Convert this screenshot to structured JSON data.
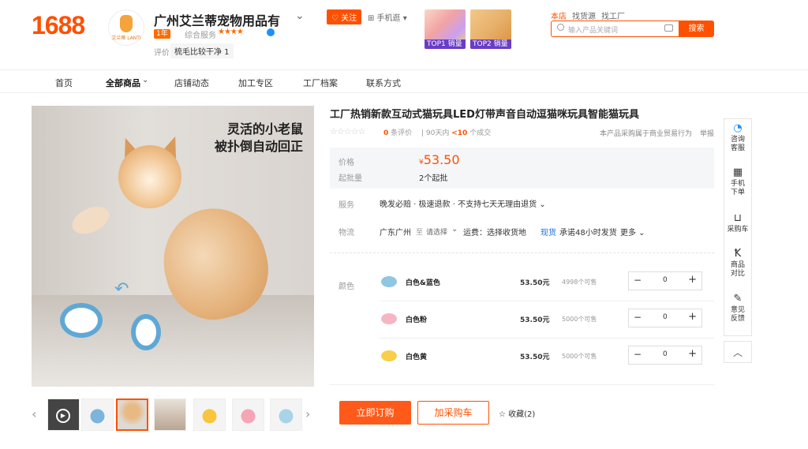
{
  "header": {
    "logo": "1688",
    "shop_avatar_label": "艾兰蒂 LANTI",
    "shop_name": "广州艾兰蒂宠物用品有",
    "years_badge": "1年",
    "overall_service_label": "综合服务",
    "overall_stars": "★★★★",
    "review_label": "评价",
    "review_tag": "梳毛比较干净 1",
    "follow_label": "♡ 关注",
    "mobile_wangwang": "⊞ 手机逛 ▾",
    "promo_1_badge": "TOP1 销量",
    "promo_2_badge": "TOP2 销量"
  },
  "search": {
    "tabs": [
      "本店",
      "找货源",
      "找工厂"
    ],
    "placeholder": "输入产品关键词",
    "button": "搜索"
  },
  "nav": {
    "items": [
      "首页",
      "全部商品",
      "店铺动态",
      "加工专区",
      "工厂档案",
      "联系方式"
    ]
  },
  "gallery": {
    "overlay_line_1": "灵活的小老鼠",
    "overlay_line_2": "被扑倒自动回正",
    "thumb_count": 7,
    "selected_thumb": 3
  },
  "product": {
    "title": "工厂热销新款互动式猫玩具LED灯带声音自动逗猫咪玩具智能猫玩具",
    "rating_stars": "☆☆☆☆☆",
    "review_count_num": "0",
    "review_count_suffix": "条评价",
    "sales_prefix": "90天内",
    "sales_num": "<10",
    "sales_suffix": "个成交",
    "trade_note": "本产品采购属于商业贸易行为",
    "report": "举报"
  },
  "pricing": {
    "price_label": "价格",
    "currency": "¥",
    "price": "53.50",
    "moq_label": "起批量",
    "moq": "2个起批"
  },
  "service": {
    "label": "服务",
    "value": "晚发必赔 · 极速退款 · 不支持七天无理由退货 ⌄"
  },
  "logistics": {
    "label": "物流",
    "from": "广东广州",
    "to": "至",
    "select": "请选择",
    "fee": "运费：选择收货地",
    "stock": "现货",
    "promise": "承诺48小时发货",
    "more": "更多 ⌄"
  },
  "sku": {
    "label": "颜色",
    "rows": [
      {
        "name": "白色&蓝色",
        "price": "53.50元",
        "stock": "4998个可售",
        "qty": "0",
        "color": "#8fc6e2"
      },
      {
        "name": "白色粉",
        "price": "53.50元",
        "stock": "5000个可售",
        "qty": "0",
        "color": "#f5b6c3"
      },
      {
        "name": "白色黄",
        "price": "53.50元",
        "stock": "5000个可售",
        "qty": "0",
        "color": "#f7cf4a"
      }
    ]
  },
  "actions": {
    "buy_now": "立即订购",
    "add_cart": "加采购车",
    "favorite": "☆ 收藏(2)"
  },
  "rail": {
    "service": "咨询\n客服",
    "mobile": "手机\n下单",
    "cart": "采购车",
    "compare": "商品\n对比",
    "feedback": "意见\n反馈",
    "top": "︿"
  }
}
